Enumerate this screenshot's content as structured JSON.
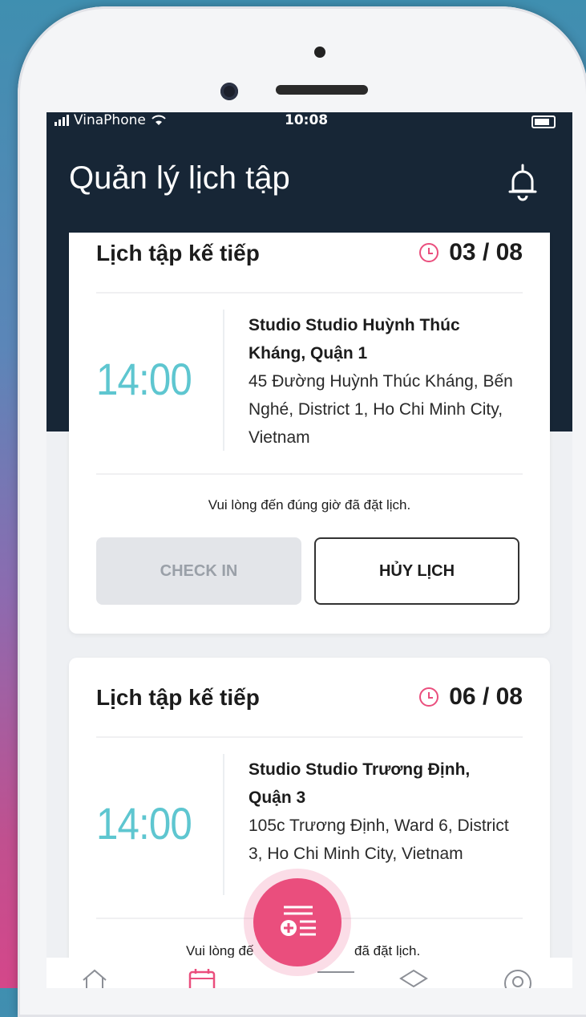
{
  "status_bar": {
    "carrier": "VinaPhone",
    "time": "10:08"
  },
  "header": {
    "title": "Quản lý lịch tập",
    "icons": [
      "bell-icon"
    ]
  },
  "bookings": [
    {
      "title": "Lịch tập kế tiếp",
      "date": "03 / 08",
      "time": "14:00",
      "studio_name": "Studio Studio Huỳnh Thúc Kháng, Quận 1",
      "address": "45 Đường Huỳnh Thúc Kháng, Bến Nghé, District 1, Ho Chi Minh City, Vietnam",
      "note": "Vui lòng đến đúng giờ đã đặt lịch.",
      "checkin_label": "CHECK IN",
      "cancel_label": "HỦY LỊCH"
    },
    {
      "title": "Lịch tập kế tiếp",
      "date": "06 / 08",
      "time": "14:00",
      "studio_name": "Studio Studio Trương Định, Quận 3",
      "address": "105c Trương Định, Ward 6, District 3, Ho Chi Minh City, Vietnam",
      "note_left": "Vui lòng đế",
      "note_right": "đã đặt lịch."
    }
  ],
  "bottom_nav": {
    "items": [
      "home-icon",
      "calendar-icon",
      "add-booking-icon",
      "layers-icon",
      "profile-icon"
    ]
  },
  "colors": {
    "header_bg": "#172636",
    "accent_time": "#5ec6d0",
    "accent_pink": "#ea4e7d"
  }
}
